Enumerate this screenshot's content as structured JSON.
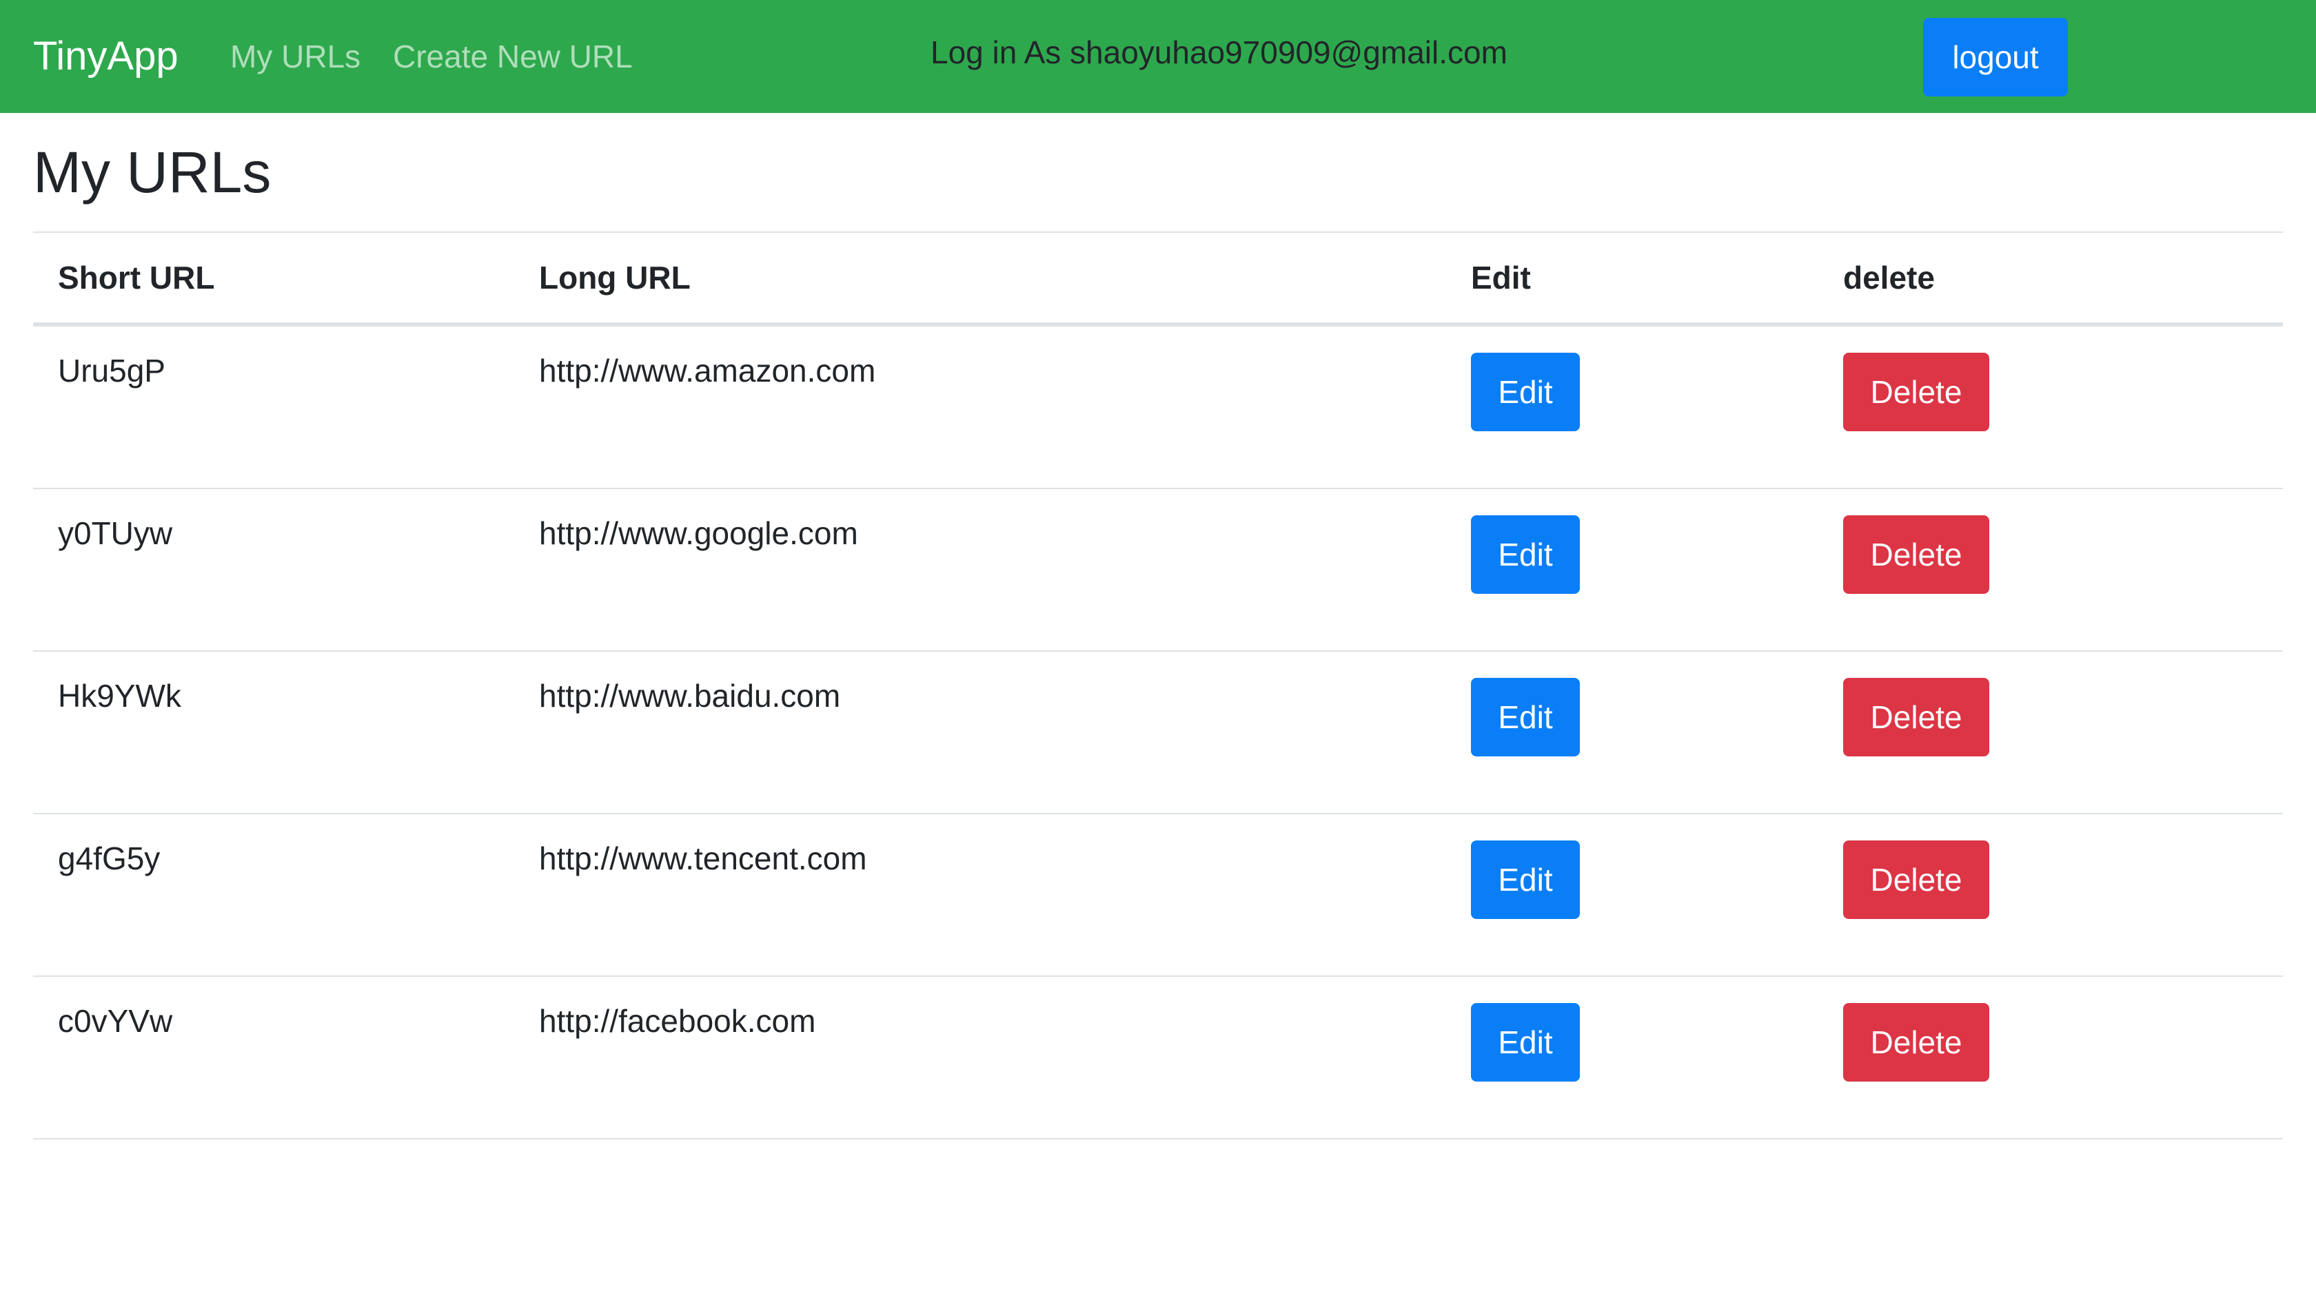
{
  "nav": {
    "brand": "TinyApp",
    "links": [
      "My URLs",
      "Create New URL"
    ],
    "login_text": "Log in As shaoyuhao970909@gmail.com",
    "logout_label": "logout"
  },
  "page": {
    "title": "My URLs"
  },
  "table": {
    "headers": [
      "Short URL",
      "Long URL",
      "Edit",
      "delete"
    ],
    "rows": [
      {
        "short": "Uru5gP",
        "long": "http://www.amazon.com",
        "edit": "Edit",
        "delete": "Delete"
      },
      {
        "short": "y0TUyw",
        "long": "http://www.google.com",
        "edit": "Edit",
        "delete": "Delete"
      },
      {
        "short": "Hk9YWk",
        "long": "http://www.baidu.com",
        "edit": "Edit",
        "delete": "Delete"
      },
      {
        "short": "g4fG5y",
        "long": "http://www.tencent.com",
        "edit": "Edit",
        "delete": "Delete"
      },
      {
        "short": "c0vYVw",
        "long": "http://facebook.com",
        "edit": "Edit",
        "delete": "Delete"
      }
    ]
  },
  "colors": {
    "navbar": "#2ea84d",
    "primary": "#0a7ef7",
    "danger": "#dc3545"
  }
}
